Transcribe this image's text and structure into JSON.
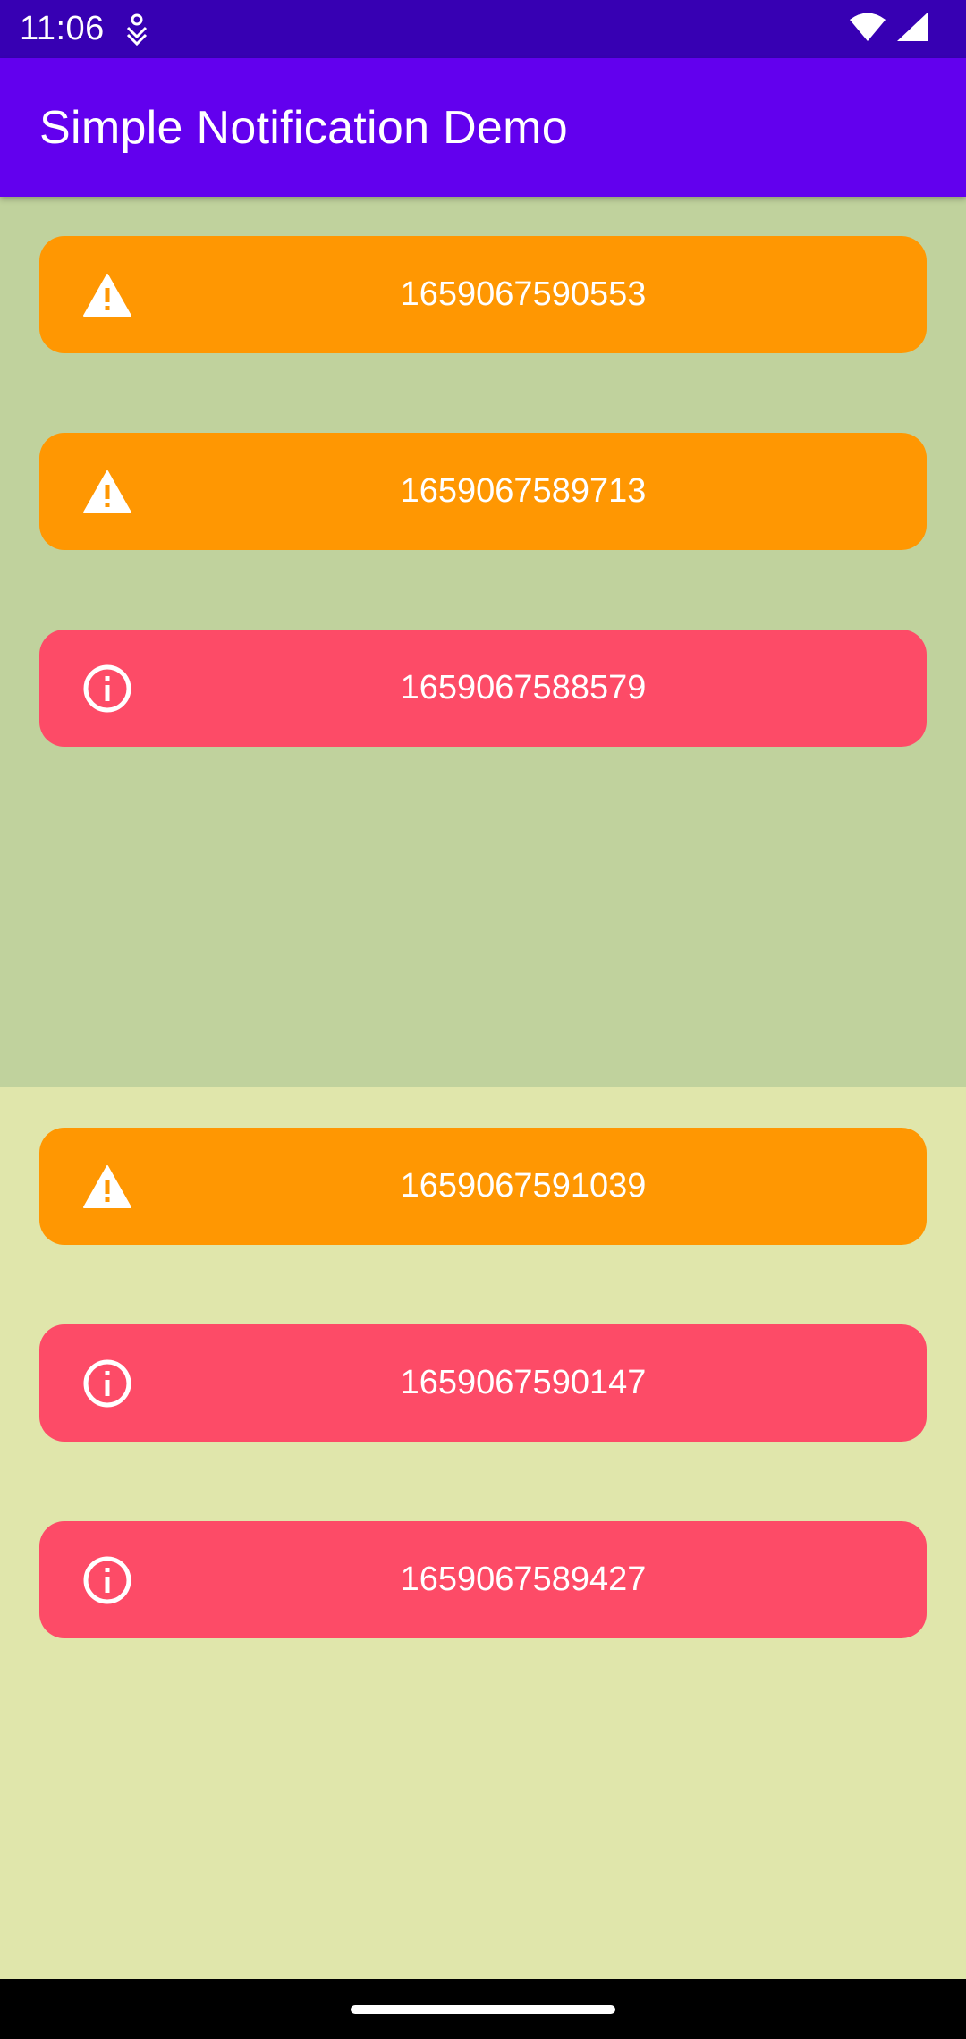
{
  "status_bar": {
    "time": "11:06",
    "icons": [
      "notification-icon",
      "wifi-icon",
      "signal-icon"
    ]
  },
  "app_bar": {
    "title": "Simple Notification Demo"
  },
  "colors": {
    "status_bar": "#3700b3",
    "app_bar": "#6200ee",
    "top_section_bg": "#c0d29d",
    "bottom_section_bg": "#e0e6ab",
    "warning": "#ff9702",
    "info": "#fd4b67"
  },
  "top_section": {
    "notifications": [
      {
        "type": "warning",
        "icon": "warning-icon",
        "text": "1659067590553"
      },
      {
        "type": "warning",
        "icon": "warning-icon",
        "text": "1659067589713"
      },
      {
        "type": "info",
        "icon": "info-icon",
        "text": "1659067588579"
      }
    ]
  },
  "bottom_section": {
    "notifications": [
      {
        "type": "warning",
        "icon": "warning-icon",
        "text": "1659067591039"
      },
      {
        "type": "info",
        "icon": "info-icon",
        "text": "1659067590147"
      },
      {
        "type": "info",
        "icon": "info-icon",
        "text": "1659067589427"
      }
    ]
  }
}
